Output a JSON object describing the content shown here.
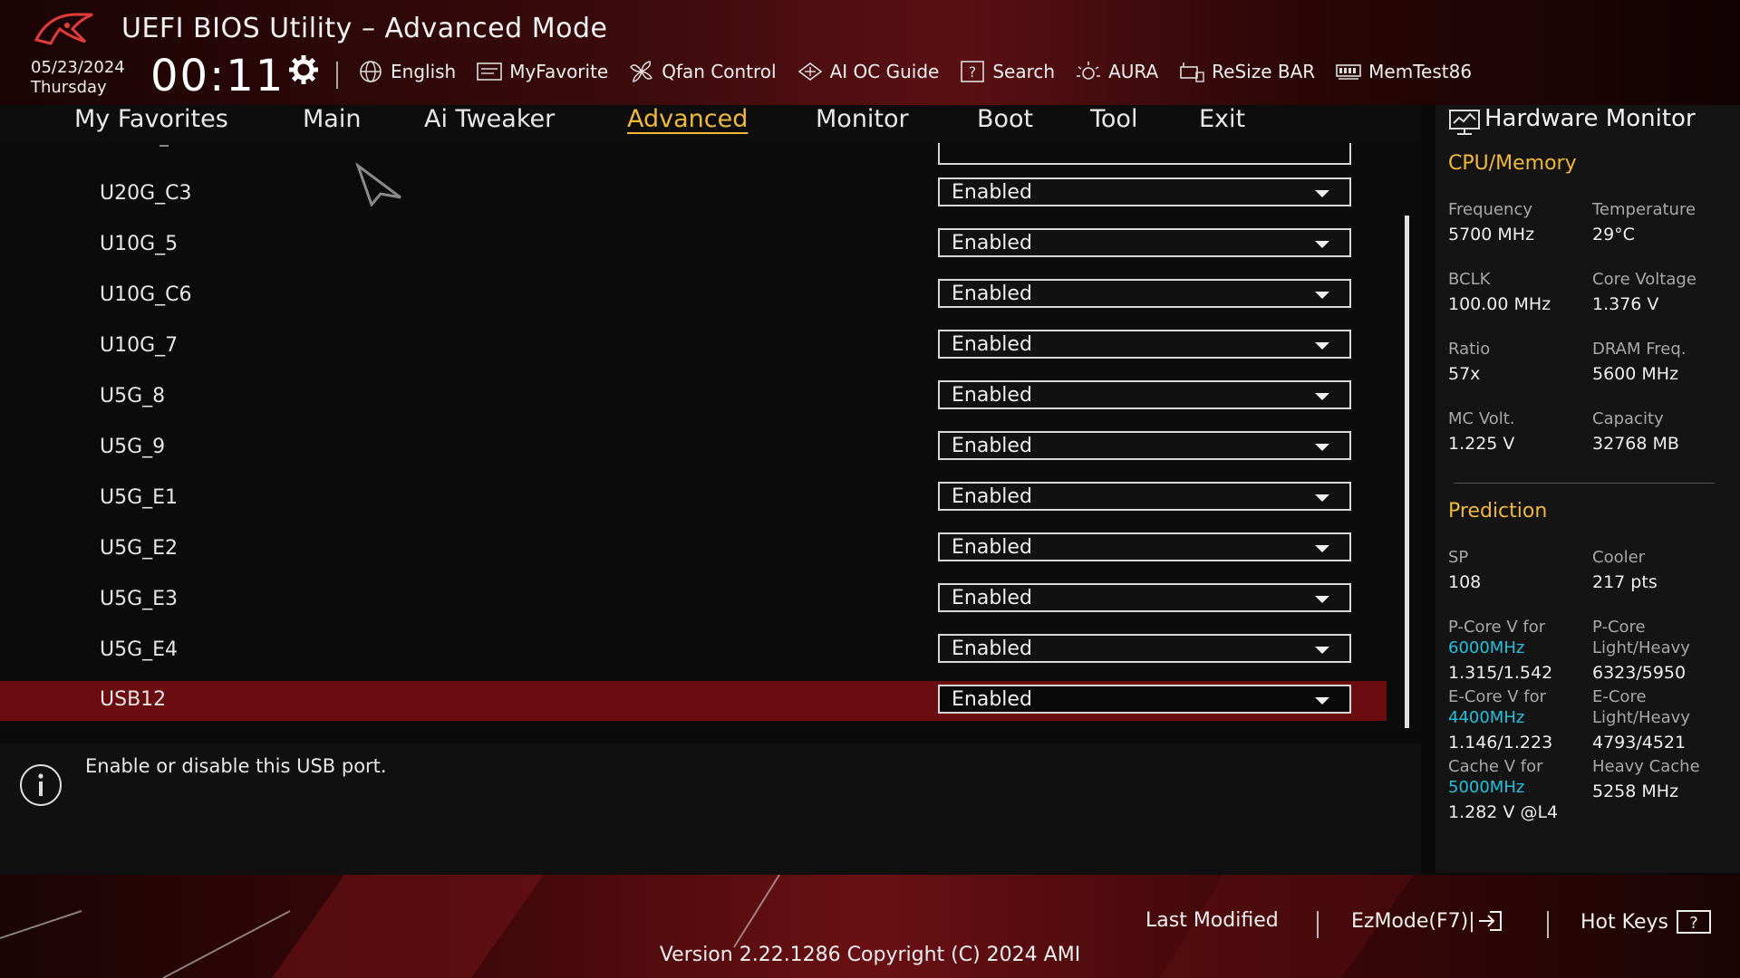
{
  "header": {
    "title": "UEFI BIOS Utility – Advanced Mode",
    "date": "05/23/2024",
    "day": "Thursday",
    "time": "00:11",
    "toolbar": [
      {
        "label": "English",
        "icon": "globe-icon"
      },
      {
        "label": "MyFavorite",
        "icon": "favorite-icon"
      },
      {
        "label": "Qfan Control",
        "icon": "fan-icon"
      },
      {
        "label": "AI OC Guide",
        "icon": "ai-chip-icon"
      },
      {
        "label": "Search",
        "icon": "help-search-icon"
      },
      {
        "label": "AURA",
        "icon": "aura-light-icon"
      },
      {
        "label": "ReSize BAR",
        "icon": "resize-bar-icon"
      },
      {
        "label": "MemTest86",
        "icon": "memory-icon"
      }
    ]
  },
  "nav": {
    "tabs": [
      {
        "label": "My Favorites",
        "active": false
      },
      {
        "label": "Main",
        "active": false
      },
      {
        "label": "Ai Tweaker",
        "active": false
      },
      {
        "label": "Advanced",
        "active": true
      },
      {
        "label": "Monitor",
        "active": false
      },
      {
        "label": "Boot",
        "active": false
      },
      {
        "label": "Tool",
        "active": false
      },
      {
        "label": "Exit",
        "active": false
      }
    ]
  },
  "settings": {
    "rows": [
      {
        "label": "U20G_C3",
        "value": "Enabled",
        "selected": false
      },
      {
        "label": "U10G_5",
        "value": "Enabled",
        "selected": false
      },
      {
        "label": "U10G_C6",
        "value": "Enabled",
        "selected": false
      },
      {
        "label": "U10G_7",
        "value": "Enabled",
        "selected": false
      },
      {
        "label": "U5G_8",
        "value": "Enabled",
        "selected": false
      },
      {
        "label": "U5G_9",
        "value": "Enabled",
        "selected": false
      },
      {
        "label": "U5G_E1",
        "value": "Enabled",
        "selected": false
      },
      {
        "label": "U5G_E2",
        "value": "Enabled",
        "selected": false
      },
      {
        "label": "U5G_E3",
        "value": "Enabled",
        "selected": false
      },
      {
        "label": "U5G_E4",
        "value": "Enabled",
        "selected": false
      },
      {
        "label": "USB12",
        "value": "Enabled",
        "selected": true
      }
    ]
  },
  "help": {
    "text": "Enable or disable this USB port."
  },
  "hardware_monitor": {
    "title": "Hardware Monitor",
    "cpu_section": "CPU/Memory",
    "frequency_label": "Frequency",
    "frequency_value": "5700 MHz",
    "temperature_label": "Temperature",
    "temperature_value": "29°C",
    "bclk_label": "BCLK",
    "bclk_value": "100.00 MHz",
    "core_voltage_label": "Core Voltage",
    "core_voltage_value": "1.376 V",
    "ratio_label": "Ratio",
    "ratio_value": "57x",
    "dram_freq_label": "DRAM Freq.",
    "dram_freq_value": "5600 MHz",
    "mc_volt_label": "MC Volt.",
    "mc_volt_value": "1.225 V",
    "capacity_label": "Capacity",
    "capacity_value": "32768 MB",
    "prediction_section": "Prediction",
    "sp_label": "SP",
    "sp_value": "108",
    "cooler_label": "Cooler",
    "cooler_value": "217 pts",
    "pcore_v_label": "P-Core V for",
    "pcore_v_freq": "6000MHz",
    "pcore_v_value": "1.315/1.542",
    "pcore_lh_label1": "P-Core",
    "pcore_lh_label2": "Light/Heavy",
    "pcore_lh_value": "6323/5950",
    "ecore_v_label": "E-Core V for",
    "ecore_v_freq": "4400MHz",
    "ecore_v_value": "1.146/1.223",
    "ecore_lh_label1": "E-Core",
    "ecore_lh_label2": "Light/Heavy",
    "ecore_lh_value": "4793/4521",
    "cache_v_label": "Cache V for",
    "cache_v_freq": "5000MHz",
    "cache_v_value": "1.282 V @L4",
    "heavy_cache_label": "Heavy Cache",
    "heavy_cache_value": "5258 MHz"
  },
  "footer": {
    "last_modified": "Last Modified",
    "ezmode": "EzMode(F7)|",
    "hotkeys": "Hot Keys",
    "version": "Version 2.22.1286 Copyright (C) 2024 AMI"
  },
  "colors": {
    "accent": "#f0b93a",
    "selected_row": "#6b0c10",
    "cyan": "#26c0dd"
  }
}
